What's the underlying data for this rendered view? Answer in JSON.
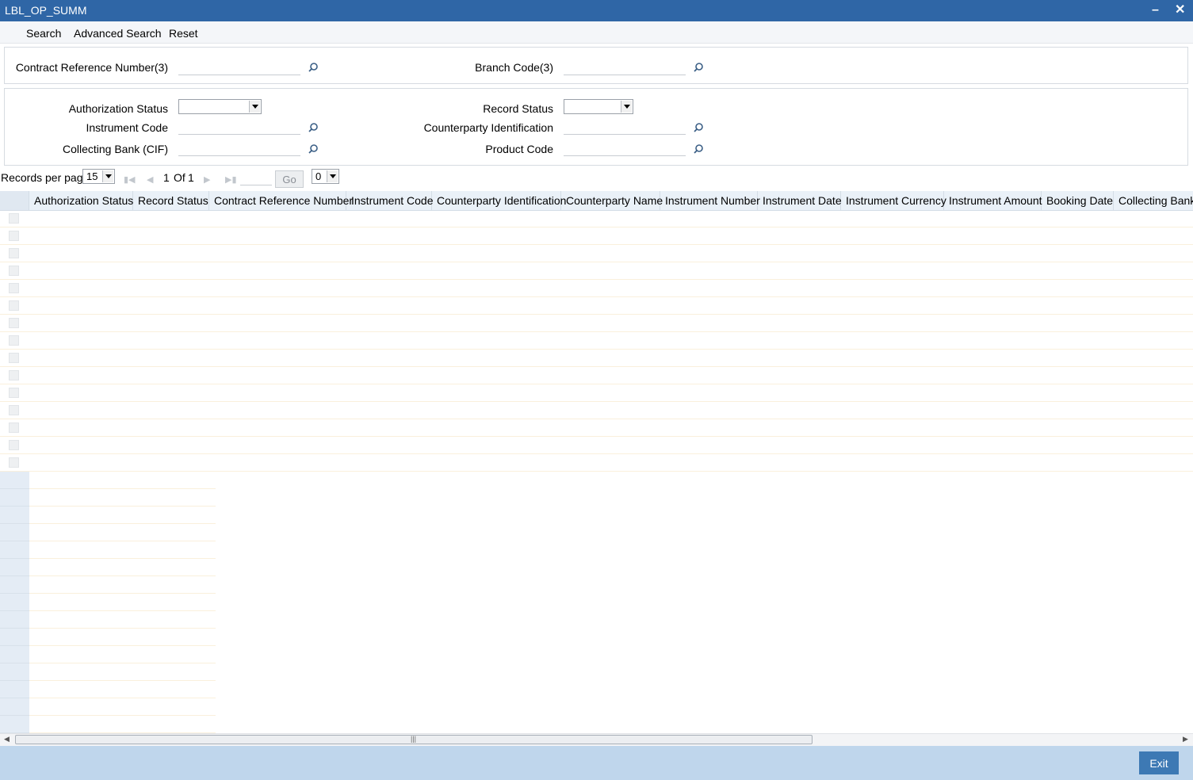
{
  "window": {
    "title": "LBL_OP_SUMM"
  },
  "toolbar": {
    "search": "Search",
    "advanced_search": "Advanced Search",
    "reset": "Reset"
  },
  "filters": {
    "contract_ref_label": "Contract Reference Number(3)",
    "branch_code_label": "Branch Code(3)",
    "auth_status_label": "Authorization Status",
    "record_status_label": "Record Status",
    "instrument_code_label": "Instrument Code",
    "counterparty_id_label": "Counterparty Identification",
    "collecting_bank_label": "Collecting Bank (CIF)",
    "product_code_label": "Product Code"
  },
  "pager": {
    "records_label": "Records per page",
    "records_value": "15",
    "page_current": "1",
    "page_of": "Of",
    "page_total": "1",
    "go_label": "Go",
    "jump_value": "0"
  },
  "table": {
    "columns": [
      "Authorization Status",
      "Record Status",
      "Contract Reference Number",
      "Instrument Code",
      "Counterparty Identification",
      "Counterparty Name",
      "Instrument Number",
      "Instrument Date",
      "Instrument Currency",
      "Instrument Amount",
      "Booking Date",
      "Collecting Bank"
    ],
    "rows": []
  },
  "footer": {
    "exit_label": "Exit"
  }
}
